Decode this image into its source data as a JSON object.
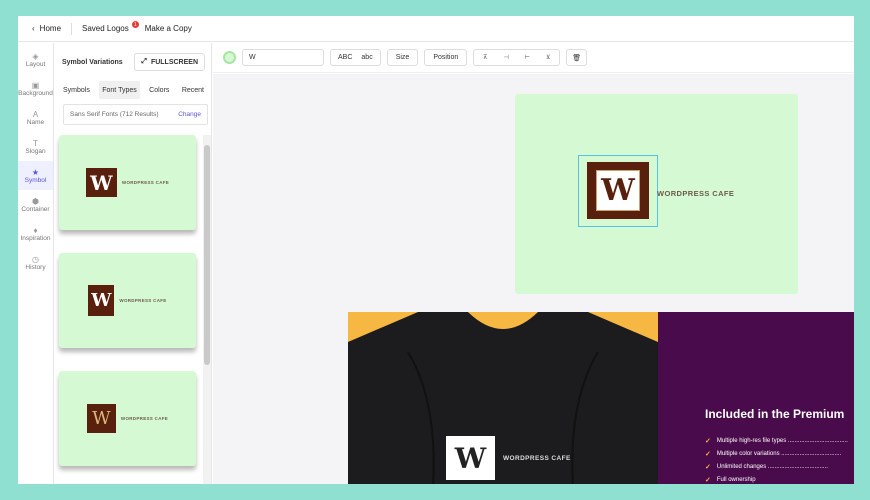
{
  "topbar": {
    "home": "Home",
    "saved_logos": "Saved Logos",
    "saved_logos_badge": "1",
    "make_copy": "Make a Copy"
  },
  "leftnav": {
    "items": [
      {
        "label": "Layout",
        "icon": "layers-icon"
      },
      {
        "label": "Background",
        "icon": "background-icon"
      },
      {
        "label": "Name",
        "icon": "text-a-icon"
      },
      {
        "label": "Slogan",
        "icon": "text-t-icon"
      },
      {
        "label": "Symbol",
        "icon": "star-icon",
        "active": true
      },
      {
        "label": "Container",
        "icon": "container-icon"
      },
      {
        "label": "Inspiration",
        "icon": "bulb-icon"
      },
      {
        "label": "History",
        "icon": "history-icon"
      }
    ]
  },
  "panel": {
    "title": "Symbol Variations",
    "fullscreen_label": "FULLSCREEN",
    "tabs": [
      "Symbols",
      "Font Types",
      "Colors",
      "Recent"
    ],
    "active_tab": "Font Types",
    "filter_text": "Sans Serif Fonts (712 Results)",
    "change_label": "Change",
    "cards": [
      {
        "letter": "W",
        "brand": "WORDPRESS CAFE"
      },
      {
        "letter": "W",
        "brand": "WORDPRESS CAFE"
      },
      {
        "letter": "W",
        "brand": "WORDPRESS CAFE"
      }
    ]
  },
  "toolbar": {
    "text_value": "W",
    "case_upper": "ABC",
    "case_lower": "abc",
    "size_label": "Size",
    "position_label": "Position"
  },
  "canvas": {
    "letter": "W",
    "brand": "WORDPRESS CAFE",
    "mockup_brand": "WORDPRESS CAFE",
    "premium_title": "Included in the Premium",
    "premium_items": [
      "Multiple high-res file types ....................................",
      "Multiple color variations ....................................",
      "Unlimited changes ....................................",
      "Full ownership"
    ]
  },
  "colors": {
    "logo_bg": "#d5fad3",
    "symbol": "#5a200e",
    "accent": "#5b55d6",
    "premium_bg": "#4a0b4c",
    "mockup_bg": "#f7b743"
  }
}
